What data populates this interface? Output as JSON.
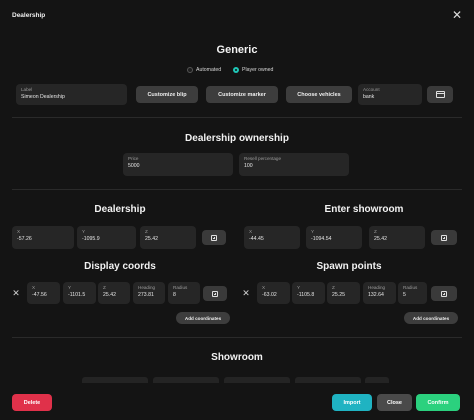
{
  "window": {
    "title": "Dealership"
  },
  "generic": {
    "heading": "Generic",
    "mode_options": [
      {
        "label": "Automated",
        "selected": false
      },
      {
        "label": "Player owned",
        "selected": true
      }
    ],
    "label_field": {
      "label": "Label",
      "value": "Simeon Dealership"
    },
    "buttons": {
      "customize_blip": "Customize blip",
      "customize_marker": "Customize marker",
      "choose_vehicles": "Choose vehicles"
    },
    "account_field": {
      "label": "Account",
      "value": "bank"
    },
    "account_icon": "card-icon"
  },
  "ownership": {
    "heading": "Dealership ownership",
    "price": {
      "label": "Price",
      "value": "5000"
    },
    "resell": {
      "label": "Resell percentage",
      "value": "100"
    }
  },
  "dealership": {
    "heading": "Dealership",
    "x": {
      "label": "X",
      "value": "-57.26"
    },
    "y": {
      "label": "Y",
      "value": "-1095.9"
    },
    "z": {
      "label": "Z",
      "value": "25.42"
    }
  },
  "enter_showroom": {
    "heading": "Enter showroom",
    "x": {
      "label": "X",
      "value": "-44.45"
    },
    "y": {
      "label": "Y",
      "value": "-1094.54"
    },
    "z": {
      "label": "Z",
      "value": "25.42"
    }
  },
  "display_coords": {
    "heading": "Display coords",
    "row": {
      "x": {
        "label": "X",
        "value": "-47.56"
      },
      "y": {
        "label": "Y",
        "value": "-1101.5"
      },
      "z": {
        "label": "Z",
        "value": "25.42"
      },
      "heading": {
        "label": "Heading",
        "value": "273.81"
      },
      "radius": {
        "label": "Radius",
        "value": "8"
      }
    },
    "add_label": "Add coordinates"
  },
  "spawn_points": {
    "heading": "Spawn points",
    "row": {
      "x": {
        "label": "X",
        "value": "-63.02"
      },
      "y": {
        "label": "Y",
        "value": "-1105.8"
      },
      "z": {
        "label": "Z",
        "value": "25.25"
      },
      "heading": {
        "label": "Heading",
        "value": "132.64"
      },
      "radius": {
        "label": "Radius",
        "value": "5"
      }
    },
    "add_label": "Add coordinates"
  },
  "showroom": {
    "heading": "Showroom"
  },
  "footer": {
    "delete": "Delete",
    "import": "Import",
    "close": "Close",
    "confirm": "Confirm"
  },
  "colors": {
    "background": "#141414",
    "accent_teal": "#1fc7b7",
    "delete": "#e0314a",
    "import": "#1fb3c2",
    "confirm": "#2bd17e"
  }
}
